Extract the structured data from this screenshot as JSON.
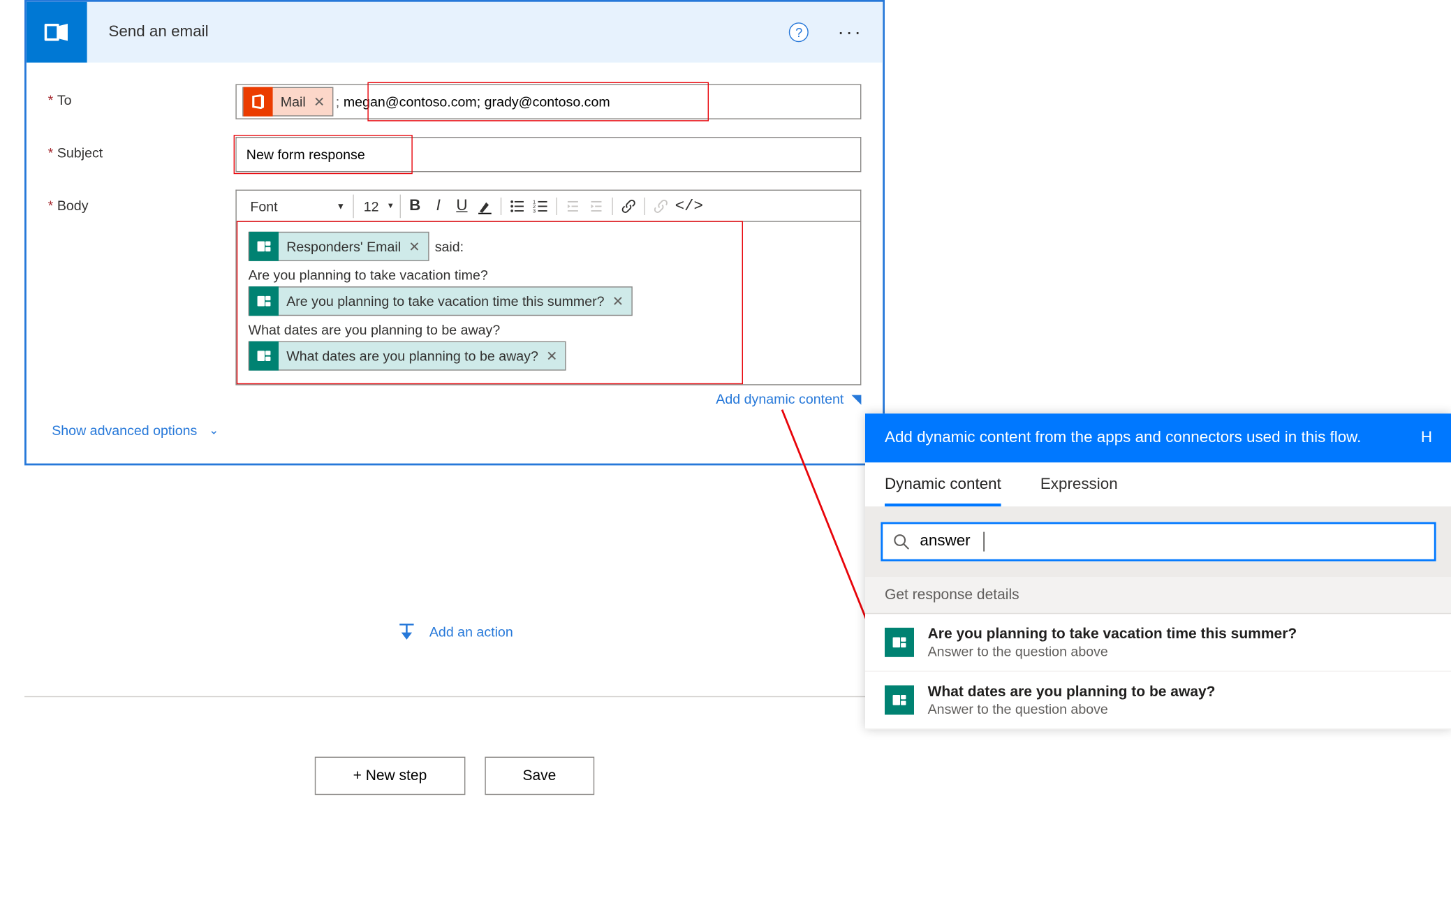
{
  "header": {
    "title": "Send an email",
    "help_label": "?",
    "more_label": "..."
  },
  "fields": {
    "to": {
      "label": "To",
      "token_label": "Mail",
      "extra_text": "megan@contoso.com; grady@contoso.com"
    },
    "subject": {
      "label": "Subject",
      "value": "New form response"
    },
    "body": {
      "label": "Body",
      "token_responders": "Responders' Email",
      "said_text": "said:",
      "line1_text": "Are you planning to take vacation time?",
      "token_q1": "Are you planning to take vacation time this summer?",
      "line2_text": "What dates are you planning to be away?",
      "token_q2": "What dates are you planning to be away?"
    }
  },
  "toolbar": {
    "font_label": "Font",
    "size_label": "12"
  },
  "footer": {
    "add_dyn": "Add dynamic content",
    "adv": "Show advanced options",
    "add_action": "Add an action",
    "new_step": "+ New step",
    "save": "Save"
  },
  "panel": {
    "header": "Add dynamic content from the apps and connectors used in this flow.",
    "tab_dynamic": "Dynamic content",
    "tab_expression": "Expression",
    "search_value": "answer",
    "section": "Get response details",
    "items": [
      {
        "title": "Are you planning to take vacation time this summer?",
        "sub": "Answer to the question above"
      },
      {
        "title": "What dates are you planning to be away?",
        "sub": "Answer to the question above"
      }
    ]
  }
}
